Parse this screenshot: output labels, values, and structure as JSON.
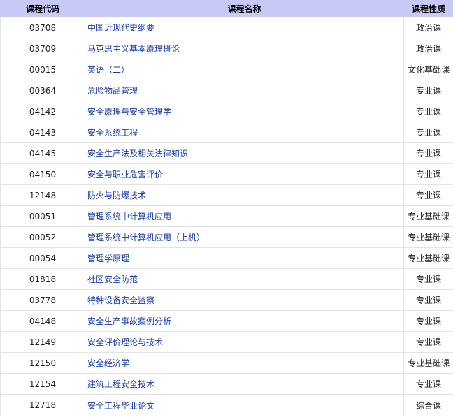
{
  "table": {
    "headers": {
      "code": "课程代码",
      "name": "课程名称",
      "type": "课程性质"
    },
    "rows": [
      {
        "code": "03708",
        "name": "中国近现代史纲要",
        "type": "政治课"
      },
      {
        "code": "03709",
        "name": "马克思主义基本原理概论",
        "type": "政治课"
      },
      {
        "code": "00015",
        "name": "英语（二）",
        "type": "文化基础课"
      },
      {
        "code": "00364",
        "name": "危险物品管理",
        "type": "专业课"
      },
      {
        "code": "04142",
        "name": "安全原理与安全管理学",
        "type": "专业课"
      },
      {
        "code": "04143",
        "name": "安全系统工程",
        "type": "专业课"
      },
      {
        "code": "04145",
        "name": "安全生产法及相关法律知识",
        "type": "专业课"
      },
      {
        "code": "04150",
        "name": "安全与职业危害评价",
        "type": "专业课"
      },
      {
        "code": "12148",
        "name": "防火与防爆技术",
        "type": "专业课"
      },
      {
        "code": "00051",
        "name": "管理系统中计算机应用",
        "type": "专业基础课"
      },
      {
        "code": "00052",
        "name": "管理系统中计算机应用（上机）",
        "type": "专业基础课"
      },
      {
        "code": "00054",
        "name": "管理学原理",
        "type": "专业基础课"
      },
      {
        "code": "01818",
        "name": "社区安全防范",
        "type": "专业课"
      },
      {
        "code": "03778",
        "name": "特种设备安全监察",
        "type": "专业课"
      },
      {
        "code": "04148",
        "name": "安全生产事故案例分析",
        "type": "专业课"
      },
      {
        "code": "12149",
        "name": "安全评价理论与技术",
        "type": "专业课"
      },
      {
        "code": "12150",
        "name": "安全经济学",
        "type": "专业基础课"
      },
      {
        "code": "12154",
        "name": "建筑工程安全技术",
        "type": "专业课"
      },
      {
        "code": "12718",
        "name": "安全工程毕业论文",
        "type": "综合课"
      }
    ]
  },
  "colors": {
    "header_bg": "#c9c9f6",
    "link": "#1a3ca8",
    "grid": "#e4e4e4"
  }
}
